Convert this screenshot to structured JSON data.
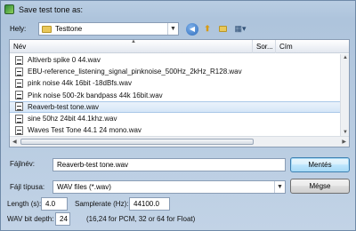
{
  "window": {
    "title": "Save test tone as:"
  },
  "toolbar": {
    "lookin_label": "Hely:",
    "lookin_value": "Testtone",
    "icons": [
      "back-arrow-icon",
      "up-folder-icon",
      "new-folder-icon",
      "views-menu-icon"
    ]
  },
  "list": {
    "columns": [
      "Név",
      "Sor...",
      "Cím"
    ],
    "files": [
      "Altiverb spike 0 44.wav",
      "EBU-reference_listening_signal_pinknoise_500Hz_2kHz_R128.wav",
      "pink noise 44k 16bit -18dBfs.wav",
      "Pink noise 500-2k bandpass 44k 16bit.wav",
      "Reaverb-test tone.wav",
      "sine 50hz 24bit 44.1khz.wav",
      "Waves Test Tone 44.1 24 mono.wav"
    ],
    "selected_index": 4
  },
  "form": {
    "filename_label": "Fájlnév:",
    "filename_value": "Reaverb-test tone.wav",
    "filetype_label": "Fájl típusa:",
    "filetype_value": "WAV files (*.wav)",
    "save_label": "Mentés",
    "cancel_label": "Mégse",
    "length_label": "Length (s):",
    "length_value": "4.0",
    "samplerate_label": "Samplerate (Hz):",
    "samplerate_value": "44100.0",
    "bitdepth_label": "WAV bit depth:",
    "bitdepth_value": "24",
    "bitdepth_hint": "(16,24 for PCM, 32 or 64 for Float)"
  },
  "colors": {
    "selection": "#d5e6f7",
    "chrome": "#b9cde3",
    "default_button": "#a7d9f5"
  }
}
